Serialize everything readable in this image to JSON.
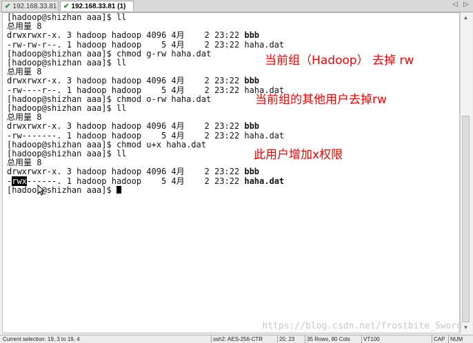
{
  "tabs": [
    {
      "label": "192.168.33.81",
      "active": false
    },
    {
      "label": "192.168.33.81 (1)",
      "active": true
    }
  ],
  "tab_nav": {
    "left": "◁",
    "right": "▷"
  },
  "terminal": {
    "lines": [
      {
        "text": "[hadoop@shizhan aaa]$ ll"
      },
      {
        "text": "总用量 8"
      },
      {
        "pre": "drwxrwxr-x. 3 hadoop hadoop 4096 4月    2 23:22 ",
        "bold": "bbb"
      },
      {
        "text": "-rw-rw-r--. 1 hadoop hadoop    5 4月    2 23:22 haha.dat"
      },
      {
        "text": "[hadoop@shizhan aaa]$ chmod g-rw haha.dat"
      },
      {
        "text": "[hadoop@shizhan aaa]$ ll"
      },
      {
        "text": "总用量 8"
      },
      {
        "pre": "drwxrwxr-x. 3 hadoop hadoop 4096 4月    2 23:22 ",
        "bold": "bbb"
      },
      {
        "text": "-rw----r--. 1 hadoop hadoop    5 4月    2 23:22 haha.dat"
      },
      {
        "text": "[hadoop@shizhan aaa]$ chmod o-rw haha.dat"
      },
      {
        "text": "[hadoop@shizhan aaa]$ ll"
      },
      {
        "text": "总用量 8"
      },
      {
        "pre": "drwxrwxr-x. 3 hadoop hadoop 4096 4月    2 23:22 ",
        "bold": "bbb"
      },
      {
        "text": "-rw-------. 1 hadoop hadoop    5 4月    2 23:22 haha.dat"
      },
      {
        "text": "[hadoop@shizhan aaa]$ chmod u+x haha.dat"
      },
      {
        "text": "[hadoop@shizhan aaa]$ ll"
      },
      {
        "text": "总用量 8"
      },
      {
        "pre": "drwxrwxr-x. 3 hadoop hadoop 4096 4月    2 23:22 ",
        "bold": "bbb"
      },
      {
        "pre": "-",
        "hl": "rwx",
        "mid": "------. 1 hadoop hadoop    5 4月    2 23:22 ",
        "bold": "haha.dat"
      },
      {
        "text": "[hadoop@shizhan aaa]$ ",
        "cursor": true
      }
    ],
    "annotations": [
      "当前组（Hadoop） 去掉 rw",
      "当前组的其他用户去掉rw",
      "此用户增加x权限"
    ],
    "watermark": "https://blog.csdn.net/frostbite_Sword"
  },
  "status_bar": {
    "selection": "Current selection: 19, 3 to 19, 4",
    "connection": "ssh2: AES-256-CTR",
    "cursor_pos": "20, 23",
    "dimensions": "35 Rows, 80 Cols",
    "terminal_type": "VT100",
    "caps": "CAP",
    "num": "NUM"
  }
}
